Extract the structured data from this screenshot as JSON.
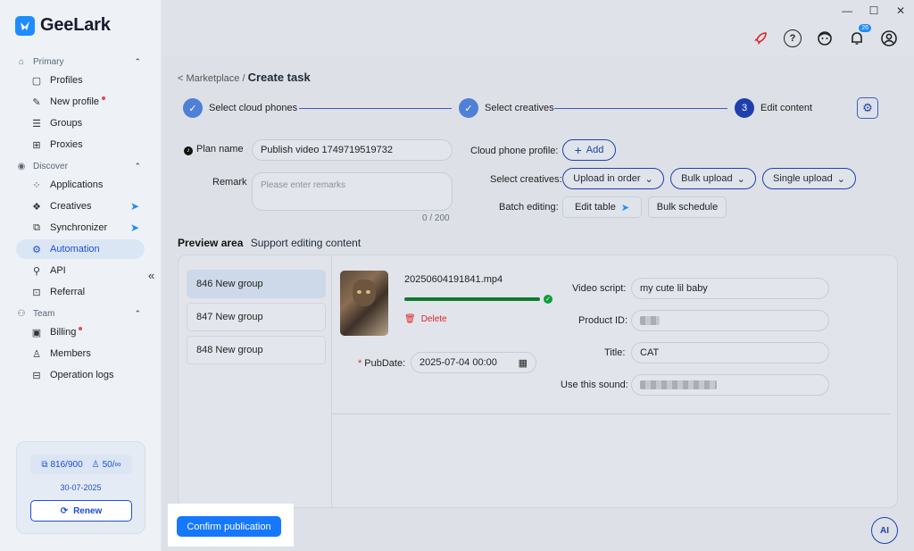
{
  "window": {
    "minimize": "—",
    "maximize": "☐",
    "close": "✕"
  },
  "brand": {
    "name": "GeeLark",
    "accent": "#1d8cff"
  },
  "sidebar": {
    "sections": [
      {
        "label": "Primary",
        "icon": "home-icon"
      },
      {
        "label": "Discover",
        "icon": "eye-icon"
      },
      {
        "label": "Team",
        "icon": "team-icon"
      }
    ],
    "items": {
      "profiles": "Profiles",
      "new_profile": "New profile",
      "groups": "Groups",
      "proxies": "Proxies",
      "applications": "Applications",
      "creatives": "Creatives",
      "synchronizer": "Synchronizer",
      "automation": "Automation",
      "api": "API",
      "referral": "Referral",
      "billing": "Billing",
      "members": "Members",
      "operation_logs": "Operation logs"
    },
    "quota": {
      "profiles": "816/900",
      "members": "50/∞",
      "date": "30-07-2025",
      "renew": "Renew"
    }
  },
  "header": {
    "notification_count": "26"
  },
  "breadcrumb": {
    "parent": "< Marketplace /",
    "current": "Create task"
  },
  "steps": [
    {
      "label": "Select cloud phones",
      "state": "done"
    },
    {
      "label": "Select creatives",
      "state": "done"
    },
    {
      "label": "Edit content",
      "number": "3",
      "state": "active"
    }
  ],
  "form": {
    "plan_name_label": "Plan name",
    "plan_name_value": "Publish video 1749719519732",
    "remark_label": "Remark",
    "remark_placeholder": "Please enter remarks",
    "remark_counter": "0 / 200",
    "cloud_profile_label": "Cloud phone profile:",
    "add_label": "Add",
    "select_creatives_label": "Select creatives:",
    "upload_in_order": "Upload in order",
    "bulk_upload": "Bulk upload",
    "single_upload": "Single upload",
    "batch_editing_label": "Batch editing:",
    "edit_table": "Edit table",
    "bulk_schedule": "Bulk schedule"
  },
  "preview": {
    "title": "Preview area",
    "subtitle": "Support editing content",
    "groups": [
      "846 New group",
      "847 New group",
      "848 New group"
    ],
    "file_name": "20250604191841.mp4",
    "progress": 1.0,
    "delete": "Delete",
    "pubdate_label": "PubDate:",
    "pubdate_value": "2025-07-04 00:00",
    "video_script_label": "Video script:",
    "video_script_value": "my cute lil baby",
    "product_id_label": "Product ID:",
    "title_label": "Title:",
    "title_value": "CAT",
    "sound_label": "Use this sound:"
  },
  "footer": {
    "confirm": "Confirm publication",
    "ai": "AI"
  }
}
